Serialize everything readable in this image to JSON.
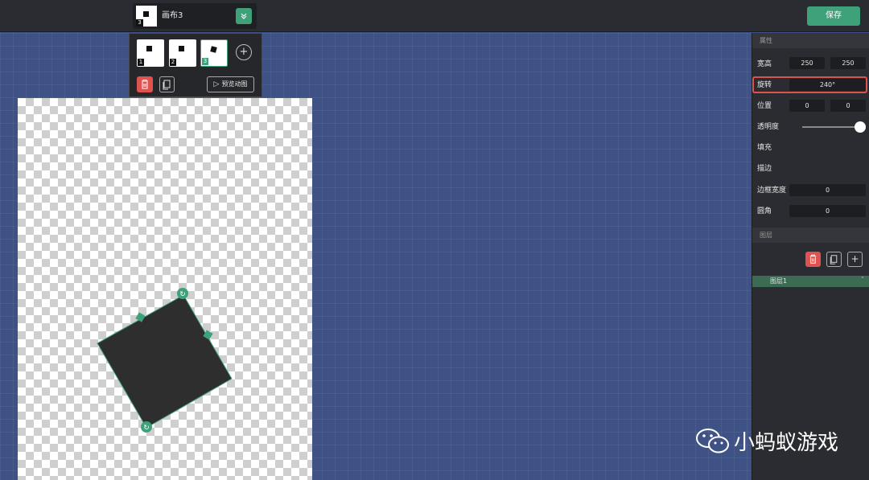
{
  "header": {
    "canvas_title": "画布3",
    "canvas_number": "3",
    "expand_icon": "chevron-double-down-icon",
    "save_label": "保存"
  },
  "frames": {
    "items": [
      {
        "number": "1",
        "active": false
      },
      {
        "number": "2",
        "active": false
      },
      {
        "number": "3",
        "active": true
      }
    ],
    "preview_label": "预览动图",
    "icons": {
      "add": "plus-icon",
      "delete": "trash-icon",
      "copy": "copy-icon",
      "play": "play-icon"
    }
  },
  "properties": {
    "section_title": "属性",
    "size_label": "宽高",
    "width": "250",
    "height": "250",
    "rotation_label": "旋转",
    "rotation": "240°",
    "position_label": "位置",
    "pos_x": "0",
    "pos_y": "0",
    "opacity_label": "透明度",
    "opacity": 1,
    "fill_label": "填充",
    "stroke_label": "描边",
    "border_width_label": "边框宽度",
    "border_width": "0",
    "radius_label": "圆角",
    "radius": "0"
  },
  "layers": {
    "section_title": "图层",
    "items": [
      {
        "label": "图层1",
        "active": true
      }
    ]
  },
  "canvas": {
    "shape_color": "#2e2e2e",
    "selection_color": "#3fa17a",
    "rotate_handle_icon": "rotate-icon"
  },
  "watermark": {
    "text": "小蚂蚁游戏",
    "icon": "wechat-icon"
  },
  "colors": {
    "accent": "#3fa17a",
    "danger": "#e0524f",
    "workspace": "#3f5285"
  }
}
